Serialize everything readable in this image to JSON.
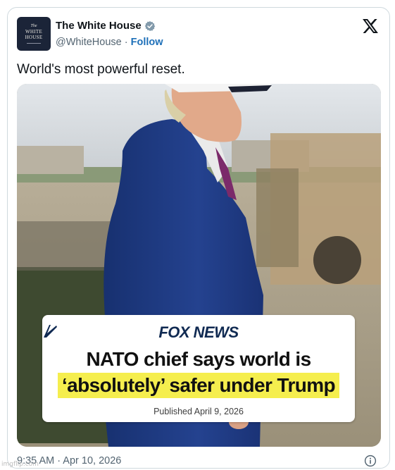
{
  "post": {
    "author_name": "The White House",
    "handle": "@WhiteHouse",
    "separator": "·",
    "follow_label": "Follow",
    "text": "World's most powerful reset.",
    "timestamp": "9:35 AM · Apr 10, 2026",
    "avatar": {
      "line1": "The",
      "line2": "WHITE",
      "line3": "HOUSE"
    },
    "verified_icon": "verified-badge-icon",
    "close_icon": "x-logo-icon",
    "info_icon": "info-icon"
  },
  "media": {
    "brand": "FOX NEWS",
    "headline_line1": "NATO chief says world is",
    "headline_line2": "‘absolutely’ safer under Trump",
    "published": "Published April 9, 2026",
    "highlight_color": "#f5ee4e"
  },
  "watermark": "imgflip.com"
}
